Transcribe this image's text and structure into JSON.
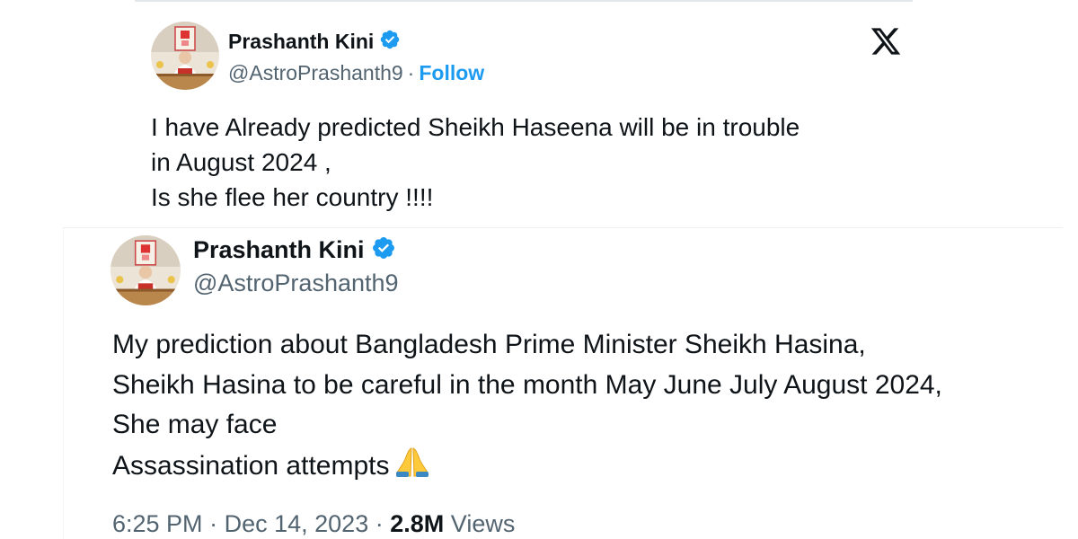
{
  "top_tweet": {
    "author_name": "Prashanth Kini",
    "handle": "@AstroPrashanth9",
    "separator": "·",
    "follow_label": "Follow",
    "platform_icon": "x-logo-icon",
    "avatar_icon": "profile-avatar",
    "verified_icon": "verified-badge-icon",
    "text_lines": [
      "I have Already predicted Sheikh Haseena will be in trouble",
      "in August 2024 ,",
      "Is she flee her country !!!!"
    ]
  },
  "bottom_tweet": {
    "author_name": "Prashanth Kini",
    "handle": "@AstroPrashanth9",
    "avatar_icon": "profile-avatar",
    "verified_icon": "verified-badge-icon",
    "text_lines": [
      "My prediction about Bangladesh Prime Minister Sheikh Hasina,",
      "Sheikh Hasina to be careful in the month May June July August 2024,",
      "She may face",
      "Assassination attempts"
    ],
    "emoji": "folded-hands-icon",
    "time": "6:25 PM",
    "separator": "·",
    "date": "Dec 14, 2023",
    "views_count": "2.8M",
    "views_label": "Views"
  },
  "colors": {
    "link_blue": "#1d9bf0",
    "verified_blue": "#1d9bf0",
    "text_primary": "#0f1419",
    "text_secondary": "#536471"
  }
}
